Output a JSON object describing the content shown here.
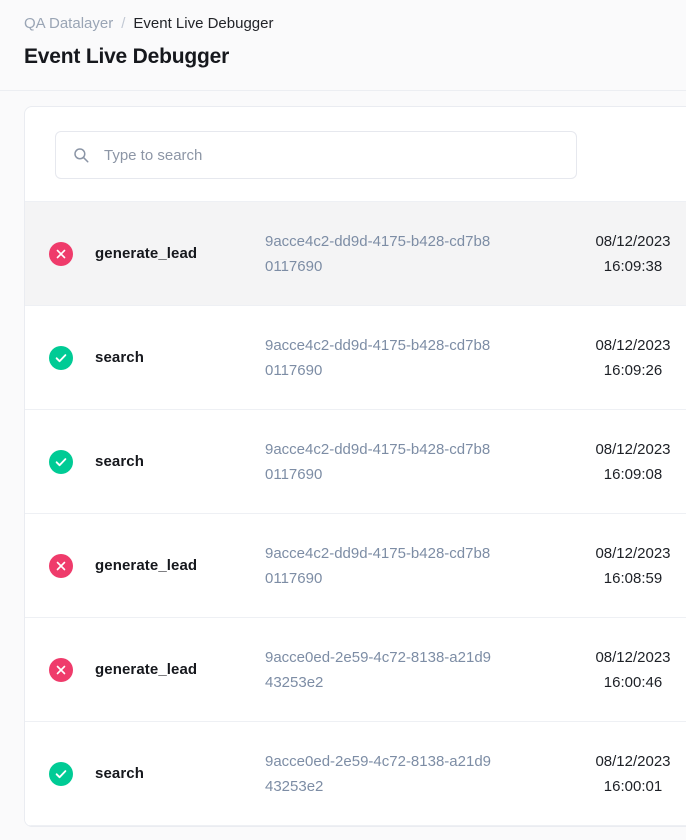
{
  "breadcrumb": {
    "parent": "QA Datalayer",
    "separator": "/",
    "current": "Event Live Debugger"
  },
  "page_title": "Event Live Debugger",
  "search": {
    "icon": "search-icon",
    "placeholder": "Type to search",
    "value": ""
  },
  "colors": {
    "success": "#00cb95",
    "error": "#ef3b6b",
    "link": "#7d8da5",
    "breadcrumb_link": "#9aa5b5",
    "row_active_bg": "#f4f4f5",
    "page_bg": "#fafafb"
  },
  "table": {
    "rows": [
      {
        "status": "error",
        "status_icon": "circle-x-icon",
        "event": "generate_lead",
        "id": "9acce4c2-dd9d-4175-b428-cd7b80117690",
        "date": "08/12/2023",
        "time": "16:09:38",
        "active": true
      },
      {
        "status": "success",
        "status_icon": "circle-check-icon",
        "event": "search",
        "id": "9acce4c2-dd9d-4175-b428-cd7b80117690",
        "date": "08/12/2023",
        "time": "16:09:26",
        "active": false
      },
      {
        "status": "success",
        "status_icon": "circle-check-icon",
        "event": "search",
        "id": "9acce4c2-dd9d-4175-b428-cd7b80117690",
        "date": "08/12/2023",
        "time": "16:09:08",
        "active": false
      },
      {
        "status": "error",
        "status_icon": "circle-x-icon",
        "event": "generate_lead",
        "id": "9acce4c2-dd9d-4175-b428-cd7b80117690",
        "date": "08/12/2023",
        "time": "16:08:59",
        "active": false
      },
      {
        "status": "error",
        "status_icon": "circle-x-icon",
        "event": "generate_lead",
        "id": "9acce0ed-2e59-4c72-8138-a21d943253e2",
        "date": "08/12/2023",
        "time": "16:00:46",
        "active": false
      },
      {
        "status": "success",
        "status_icon": "circle-check-icon",
        "event": "search",
        "id": "9acce0ed-2e59-4c72-8138-a21d943253e2",
        "date": "08/12/2023",
        "time": "16:00:01",
        "active": false
      }
    ]
  }
}
